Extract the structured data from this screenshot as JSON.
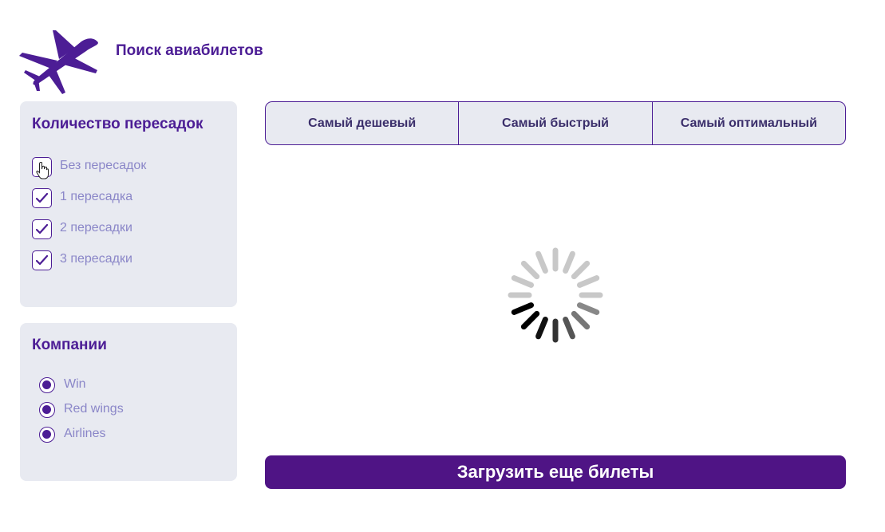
{
  "header": {
    "title": "Поиск авиабилетов",
    "logo_icon": "airplane-icon"
  },
  "colors": {
    "accent": "#4c1d95",
    "button": "#4f1485",
    "panel_bg": "#e8eaf1",
    "label": "#8a86c8"
  },
  "filters": {
    "transfers": {
      "title": "Количество пересадок",
      "items": [
        {
          "label": "Без пересадок",
          "checked": false
        },
        {
          "label": "1 пересадка",
          "checked": true
        },
        {
          "label": "2 пересадки",
          "checked": true
        },
        {
          "label": "3 пересадки",
          "checked": true
        }
      ]
    },
    "companies": {
      "title": "Компании",
      "items": [
        {
          "label": "Win",
          "selected": true
        },
        {
          "label": "Red wings",
          "selected": true
        },
        {
          "label": "Airlines",
          "selected": true
        }
      ]
    }
  },
  "sort_tabs": [
    {
      "label": "Самый дешевый"
    },
    {
      "label": "Самый быстрый"
    },
    {
      "label": "Самый оптимальный"
    }
  ],
  "loader": {
    "icon": "loading-spinner-icon"
  },
  "load_more_label": "Загрузить еще билеты"
}
